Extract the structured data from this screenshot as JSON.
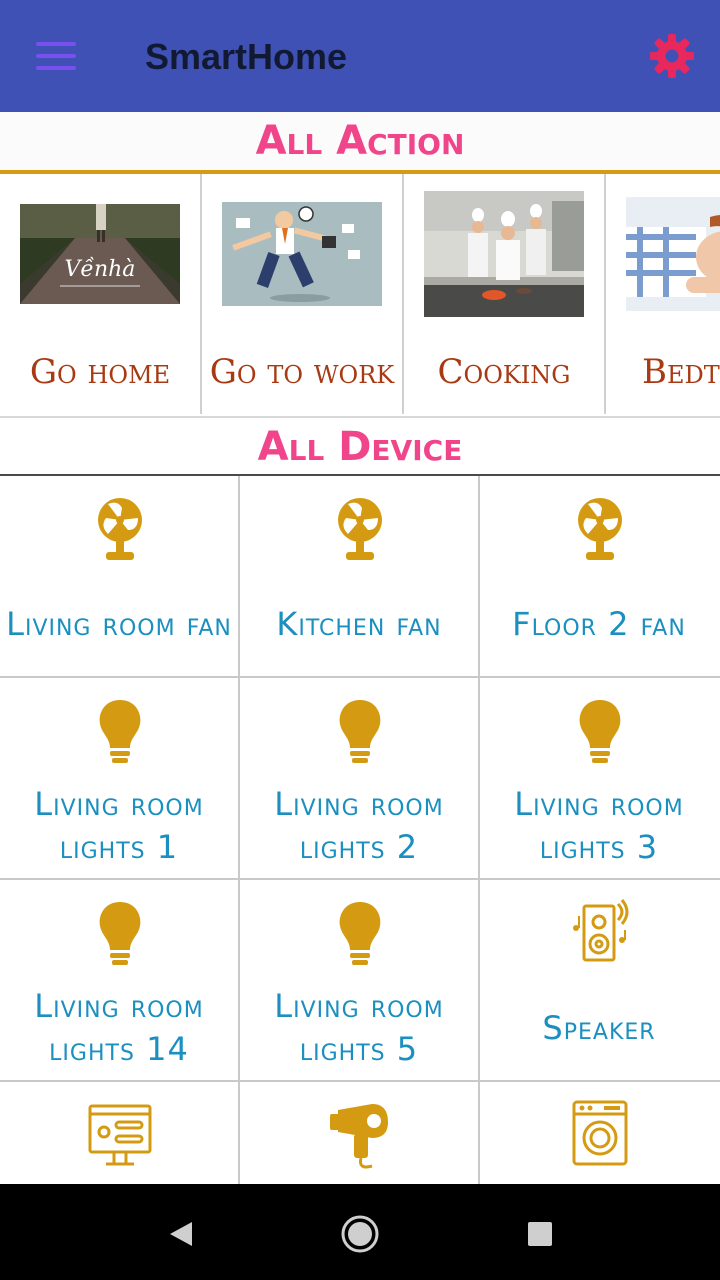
{
  "appbar": {
    "title": "SmartHome",
    "menu_icon": "hamburger-menu-icon",
    "settings_icon": "gear-icon"
  },
  "sections": {
    "actions_title": "All Action",
    "devices_title": "All Device"
  },
  "actions": [
    {
      "label": "Go home",
      "image": "forest-path-vehome-photo"
    },
    {
      "label": "Go to work",
      "image": "busy-businessman-illustration"
    },
    {
      "label": "Cooking",
      "image": "chefs-cooking-photo"
    },
    {
      "label": "Bedt",
      "image": "person-sleeping-photo"
    }
  ],
  "devices": [
    {
      "label": "Living room fan",
      "icon": "fan-icon"
    },
    {
      "label": "Kitchen fan",
      "icon": "fan-icon"
    },
    {
      "label": "Floor 2 fan",
      "icon": "fan-icon"
    },
    {
      "label": "Living room lights 1",
      "icon": "light-bulb-icon"
    },
    {
      "label": "Living room lights 2",
      "icon": "light-bulb-icon"
    },
    {
      "label": "Living room lights 3",
      "icon": "light-bulb-icon"
    },
    {
      "label": "Living room lights 14",
      "icon": "light-bulb-icon"
    },
    {
      "label": "Living room lights 5",
      "icon": "light-bulb-icon"
    },
    {
      "label": "Speaker",
      "icon": "speaker-icon"
    },
    {
      "label": "",
      "icon": "control-panel-icon"
    },
    {
      "label": "",
      "icon": "hair-dryer-icon"
    },
    {
      "label": "",
      "icon": "washing-machine-icon"
    }
  ],
  "colors": {
    "appbar": "#3f51b5",
    "accent_pink": "#f0458a",
    "action_label": "#a83a13",
    "device_label": "#1a8fc0",
    "icon_gold": "#d49b12"
  },
  "navbar": {
    "back_icon": "back-triangle-icon",
    "home_icon": "home-circle-icon",
    "recents_icon": "recents-square-icon"
  }
}
